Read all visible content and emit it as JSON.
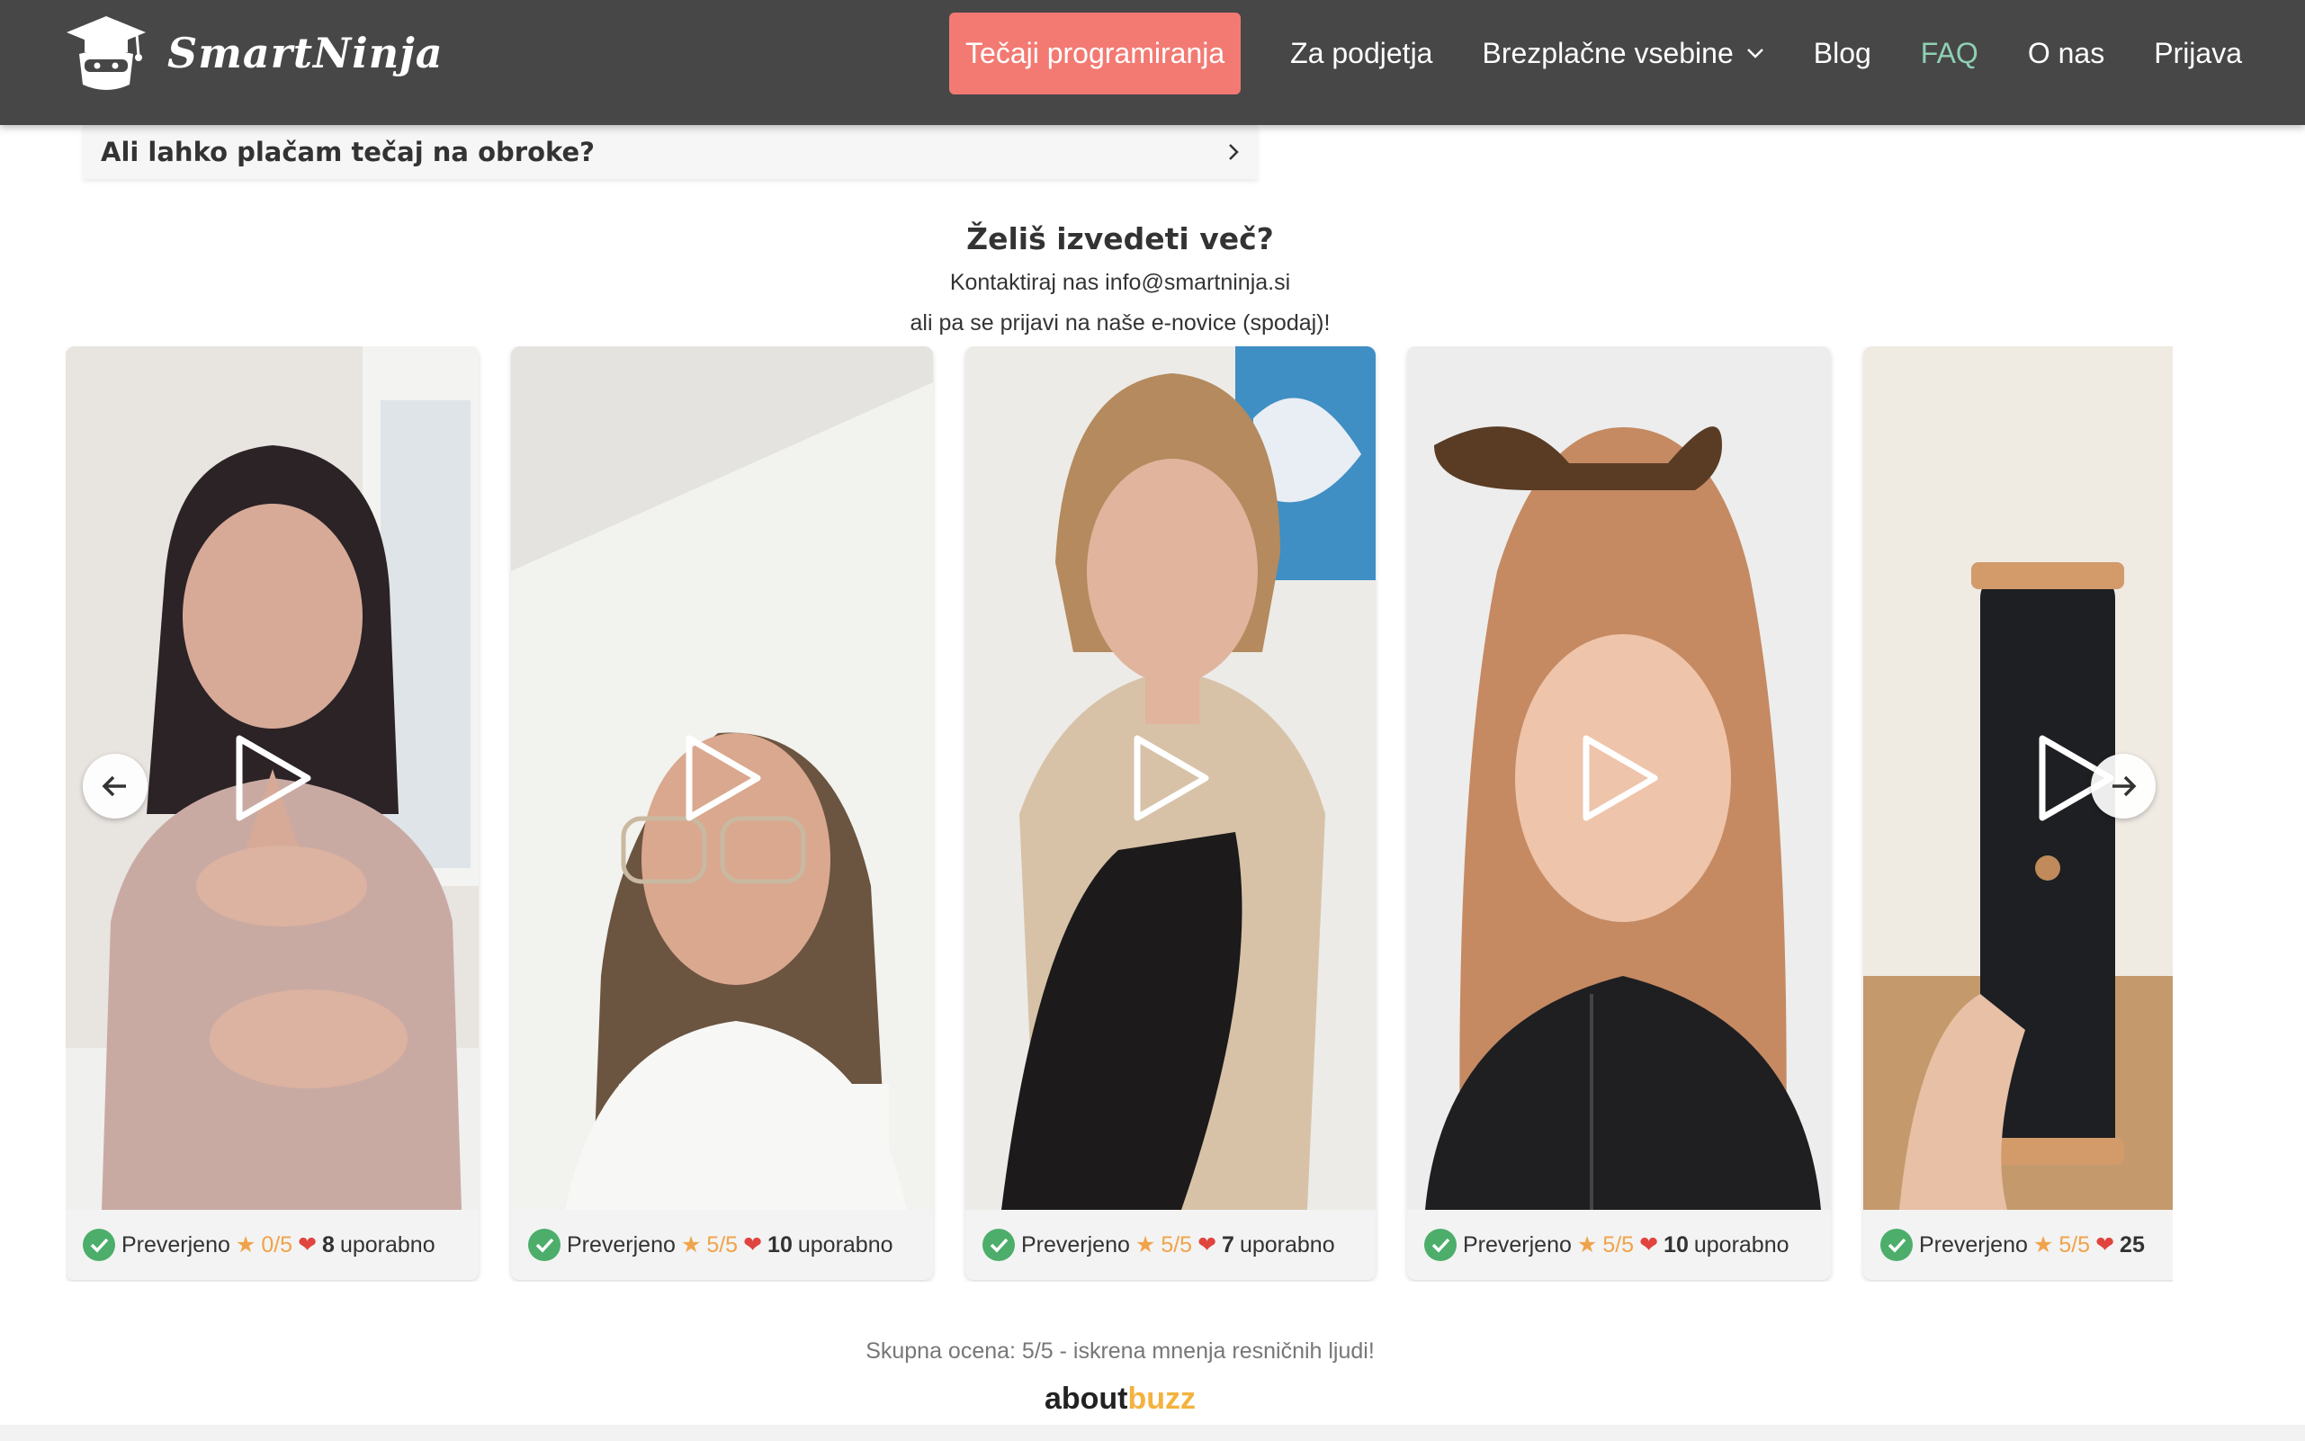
{
  "header": {
    "logo_text": "SmartNinja",
    "nav": {
      "cta": "Tečaji programiranja",
      "business": "Za podjetja",
      "free_content": "Brezplačne vsebine",
      "blog": "Blog",
      "faq": "FAQ",
      "about": "O nas",
      "login": "Prijava"
    }
  },
  "faq": {
    "question": "Ali lahko plačam tečaj na obroke?"
  },
  "contact": {
    "title": "Želiš izvedeti več?",
    "line1": "Kontaktiraj nas info@smartninja.si",
    "line2": "ali pa se prijavi na naše e-novice (spodaj)!"
  },
  "reviews": [
    {
      "verified": "Preverjeno",
      "rating": "0/5",
      "count": "8",
      "useful": "uporabno"
    },
    {
      "verified": "Preverjeno",
      "rating": "5/5",
      "count": "10",
      "useful": "uporabno"
    },
    {
      "verified": "Preverjeno",
      "rating": "5/5",
      "count": "7",
      "useful": "uporabno"
    },
    {
      "verified": "Preverjeno",
      "rating": "5/5",
      "count": "10",
      "useful": "uporabno"
    },
    {
      "verified": "Preverjeno",
      "rating": "5/5",
      "count": "25",
      "useful": ""
    }
  ],
  "footer": {
    "summary": "Skupna ocena: 5/5 - iskrena mnenja resničnih ljudi!",
    "brand_a": "about",
    "brand_b": "buzz"
  },
  "colors": {
    "header_bg": "#474747",
    "cta_bg": "#f27a73",
    "faq_active": "#8fd0b3",
    "rating": "#f0a34a",
    "verified_green": "#4cae6a",
    "brand_accent": "#f4b23e"
  }
}
